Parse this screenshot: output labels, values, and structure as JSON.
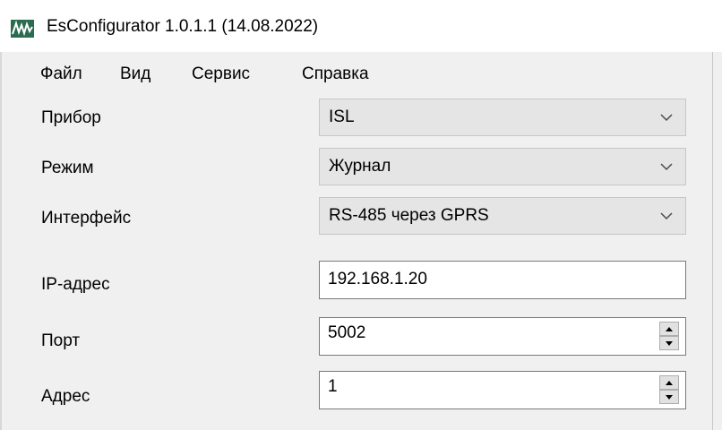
{
  "window": {
    "title": "EsConfigurator 1.0.1.1 (14.08.2022)",
    "icon": "waveform-icon",
    "accent_color": "#2b6b4f"
  },
  "menu": {
    "items": [
      "Файл",
      "Вид",
      "Сервис",
      "Справка"
    ]
  },
  "form": {
    "device": {
      "label": "Прибор",
      "value": "ISL"
    },
    "mode": {
      "label": "Режим",
      "value": "Журнал"
    },
    "interface": {
      "label": "Интерфейс",
      "value": "RS-485 через GPRS"
    },
    "ip_address": {
      "label": "IP-адрес",
      "value": "192.168.1.20"
    },
    "port": {
      "label": "Порт",
      "value": "5002"
    },
    "address": {
      "label": "Адрес",
      "value": "1"
    }
  },
  "icons": {
    "dropdown": "chevron-down-icon",
    "spin_up": "arrow-up-icon",
    "spin_down": "arrow-down-icon"
  }
}
